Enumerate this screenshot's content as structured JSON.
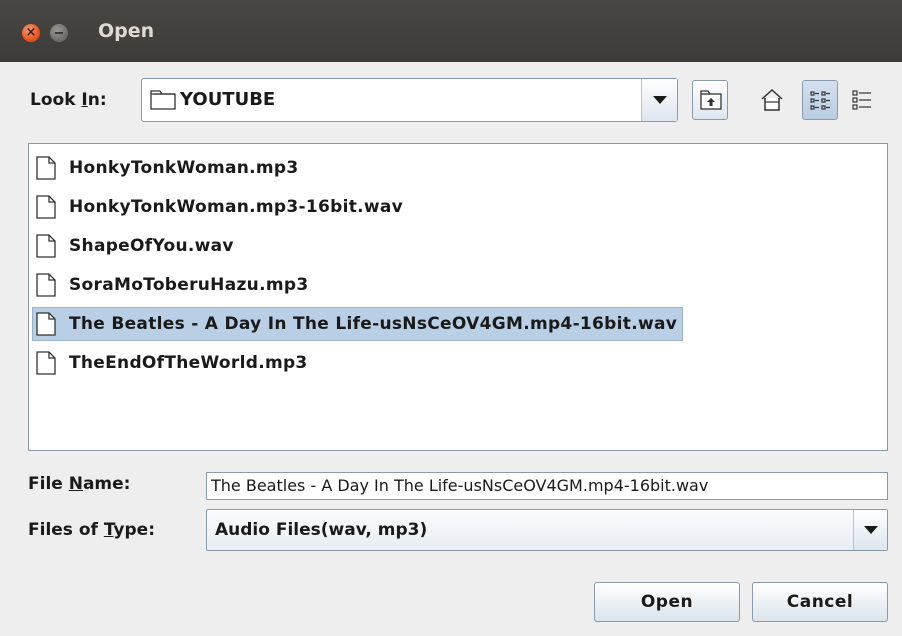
{
  "window": {
    "title": "Open"
  },
  "look_in": {
    "label_before": "Look ",
    "label_mnemonic": "I",
    "label_after": "n:",
    "value": "YOUTUBE"
  },
  "toolbar": [
    "up-one-level",
    "home",
    "list-view",
    "details-view"
  ],
  "files": [
    "HonkyTonkWoman.mp3",
    "HonkyTonkWoman.mp3-16bit.wav",
    "ShapeOfYou.wav",
    "SoraMoToberuHazu.mp3",
    "The Beatles - A Day In The Life-usNsCeOV4GM.mp4-16bit.wav",
    "TheEndOfTheWorld.mp3"
  ],
  "selected_file_index": 4,
  "file_name": {
    "label_before": "File ",
    "label_mnemonic": "N",
    "label_after": "ame:",
    "value": "The Beatles - A Day In The Life-usNsCeOV4GM.mp4-16bit.wav"
  },
  "file_type": {
    "label_before": "Files of ",
    "label_mnemonic": "T",
    "label_after": "ype:",
    "value": "Audio Files(wav, mp3)"
  },
  "buttons": {
    "open": "Open",
    "cancel": "Cancel"
  }
}
